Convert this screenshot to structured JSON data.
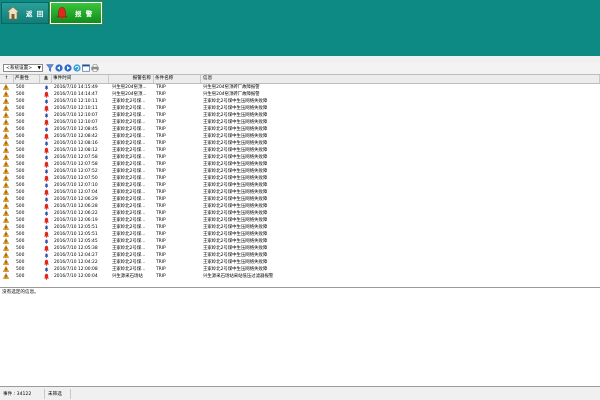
{
  "header": {
    "back_label": "返 回",
    "alarm_label": "报 警",
    "bg_color": "#0e8a84",
    "alarm_color": "#2fb834"
  },
  "toolbar": {
    "profile_value": "<系统设置>",
    "icons": [
      "filter-icon",
      "back-arrow-icon",
      "forward-arrow-icon",
      "refresh-icon",
      "window-icon",
      "print-icon"
    ]
  },
  "grid": {
    "columns": {
      "sort": "↑",
      "severity": "严重性",
      "event_time": "事件时间",
      "alarm_name": "报警名称",
      "condition_name": "条件名称",
      "info": "信息"
    },
    "rows": [
      {
        "sev": "500",
        "bell": "blue",
        "time": "2016/7/10 14:15:49",
        "name": "兴生窑204窑顶...",
        "cond": "TRIP",
        "info": "兴生窑204窑顶砖厂故障报警"
      },
      {
        "sev": "500",
        "bell": "red",
        "time": "2016/7/10 14:14:47",
        "name": "兴生窑204窑顶...",
        "cond": "TRIP",
        "info": "兴生窑204窑顶砖厂故障报警"
      },
      {
        "sev": "500",
        "bell": "blue",
        "time": "2016/7/10 12:10:11",
        "name": "王家岭北2号煤...",
        "cond": "TRIP",
        "info": "王家岭北2号煤中生压网络失败障"
      },
      {
        "sev": "500",
        "bell": "red",
        "time": "2016/7/10 12:10:11",
        "name": "王家岭北2号煤...",
        "cond": "TRIP",
        "info": "王家岭北2号煤中生压网络失败障"
      },
      {
        "sev": "500",
        "bell": "blue",
        "time": "2016/7/10 12:10:07",
        "name": "王家岭北2号煤...",
        "cond": "TRIP",
        "info": "王家岭北2号煤中生压网络失败障"
      },
      {
        "sev": "500",
        "bell": "red",
        "time": "2016/7/10 12:10:07",
        "name": "王家岭北2号煤...",
        "cond": "TRIP",
        "info": "王家岭北2号煤中生压网络失败障"
      },
      {
        "sev": "500",
        "bell": "blue",
        "time": "2016/7/10 12:08:45",
        "name": "王家岭北2号煤...",
        "cond": "TRIP",
        "info": "王家岭北2号煤中生压网络失败障"
      },
      {
        "sev": "500",
        "bell": "red",
        "time": "2016/7/10 12:08:42",
        "name": "王家岭北2号煤...",
        "cond": "TRIP",
        "info": "王家岭北2号煤中生压网络失败障"
      },
      {
        "sev": "500",
        "bell": "blue",
        "time": "2016/7/10 12:08:16",
        "name": "王家岭北2号煤...",
        "cond": "TRIP",
        "info": "王家岭北2号煤中生压网络失败障"
      },
      {
        "sev": "500",
        "bell": "red",
        "time": "2016/7/10 12:08:12",
        "name": "王家岭北2号煤...",
        "cond": "TRIP",
        "info": "王家岭北2号煤中生压网络失败障"
      },
      {
        "sev": "500",
        "bell": "blue",
        "time": "2016/7/10 12:07:58",
        "name": "王家岭北2号煤...",
        "cond": "TRIP",
        "info": "王家岭北2号煤中生压网络失败障"
      },
      {
        "sev": "500",
        "bell": "red",
        "time": "2016/7/10 12:07:58",
        "name": "王家岭北2号煤...",
        "cond": "TRIP",
        "info": "王家岭北2号煤中生压网络失败障"
      },
      {
        "sev": "500",
        "bell": "blue",
        "time": "2016/7/10 12:07:52",
        "name": "王家岭北2号煤...",
        "cond": "TRIP",
        "info": "王家岭北2号煤中生压网络失败障"
      },
      {
        "sev": "500",
        "bell": "red",
        "time": "2016/7/10 12:07:50",
        "name": "王家岭北2号煤...",
        "cond": "TRIP",
        "info": "王家岭北2号煤中生压网络失败障"
      },
      {
        "sev": "500",
        "bell": "blue",
        "time": "2016/7/10 12:07:10",
        "name": "王家岭北2号煤...",
        "cond": "TRIP",
        "info": "王家岭北2号煤中生压网络失败障"
      },
      {
        "sev": "500",
        "bell": "red",
        "time": "2016/7/10 12:07:04",
        "name": "王家岭北2号煤...",
        "cond": "TRIP",
        "info": "王家岭北2号煤中生压网络失败障"
      },
      {
        "sev": "500",
        "bell": "blue",
        "time": "2016/7/10 12:06:29",
        "name": "王家岭北2号煤...",
        "cond": "TRIP",
        "info": "王家岭北2号煤中生压网络失败障"
      },
      {
        "sev": "500",
        "bell": "red",
        "time": "2016/7/10 12:06:28",
        "name": "王家岭北2号煤...",
        "cond": "TRIP",
        "info": "王家岭北2号煤中生压网络失败障"
      },
      {
        "sev": "500",
        "bell": "blue",
        "time": "2016/7/10 12:06:22",
        "name": "王家岭北2号煤...",
        "cond": "TRIP",
        "info": "王家岭北2号煤中生压网络失败障"
      },
      {
        "sev": "500",
        "bell": "red",
        "time": "2016/7/10 12:06:19",
        "name": "王家岭北2号煤...",
        "cond": "TRIP",
        "info": "王家岭北2号煤中生压网络失败障"
      },
      {
        "sev": "500",
        "bell": "blue",
        "time": "2016/7/10 12:05:51",
        "name": "王家岭北2号煤...",
        "cond": "TRIP",
        "info": "王家岭北2号煤中生压网络失败障"
      },
      {
        "sev": "500",
        "bell": "red",
        "time": "2016/7/10 12:05:51",
        "name": "王家岭北2号煤...",
        "cond": "TRIP",
        "info": "王家岭北2号煤中生压网络失败障"
      },
      {
        "sev": "500",
        "bell": "blue",
        "time": "2016/7/10 12:05:45",
        "name": "王家岭北2号煤...",
        "cond": "TRIP",
        "info": "王家岭北2号煤中生压网络失败障"
      },
      {
        "sev": "500",
        "bell": "red",
        "time": "2016/7/10 12:05:38",
        "name": "王家岭北2号煤...",
        "cond": "TRIP",
        "info": "王家岭北2号煤中生压网络失败障"
      },
      {
        "sev": "500",
        "bell": "blue",
        "time": "2016/7/10 12:04:27",
        "name": "王家岭北2号煤...",
        "cond": "TRIP",
        "info": "王家岭北2号煤中生压网络失败障"
      },
      {
        "sev": "500",
        "bell": "red",
        "time": "2016/7/10 12:04:22",
        "name": "王家岭北2号煤...",
        "cond": "TRIP",
        "info": "王家岭北2号煤中生压网络失败障"
      },
      {
        "sev": "500",
        "bell": "blue",
        "time": "2016/7/10 12:00:08",
        "name": "王家岭北2号煤...",
        "cond": "TRIP",
        "info": "王家岭北2号煤中生压网络失败障"
      },
      {
        "sev": "500",
        "bell": "red",
        "time": "2016/7/10 12:00:04",
        "name": "兴生源采石场站",
        "cond": "TRIP",
        "info": "兴生源采石场站采站低压过滤器报警"
      }
    ]
  },
  "detail": {
    "text": "没有选定的信息。"
  },
  "status": {
    "event_count": "事件 : 34122",
    "filter_state": "未筛选"
  }
}
